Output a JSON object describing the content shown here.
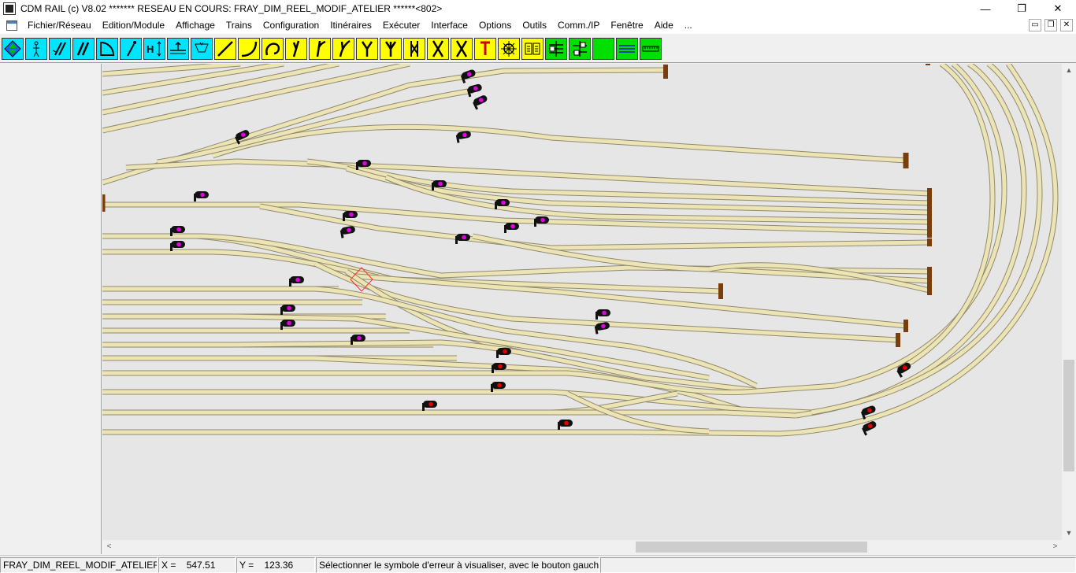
{
  "window": {
    "title": "CDM RAIL (c) V8.02      ******* RESEAU EN COURS: FRAY_DIM_REEL_MODIF_ATELIER ******<802>",
    "minimize": "—",
    "maximize": "❐",
    "close": "✕"
  },
  "menu": {
    "items": [
      "Fichier/Réseau",
      "Edition/Module",
      "Affichage",
      "Trains",
      "Configuration",
      "Itinéraires",
      "Exécuter",
      "Interface",
      "Options",
      "Outils",
      "Comm./IP",
      "Fenêtre",
      "Aide",
      "..."
    ],
    "mdi_min": "▭",
    "mdi_restore": "❐",
    "mdi_close": "✕"
  },
  "toolbar": {
    "colors": {
      "cyan": "#00e5ff",
      "yellow": "#ffff00",
      "green": "#00e000",
      "blue": "#1060ff"
    },
    "buttons": [
      {
        "name": "select-tool",
        "icon": "diamond-arrows-icon",
        "color": "cyan"
      },
      {
        "name": "track-tool",
        "icon": "stickman-icon",
        "color": "cyan"
      },
      {
        "name": "diagonal-tool",
        "icon": "diagonal-lines-icon",
        "color": "cyan"
      },
      {
        "name": "double-track-tool",
        "icon": "double-lines-icon",
        "color": "cyan"
      },
      {
        "name": "curve-tool",
        "icon": "curve-shape-icon",
        "color": "cyan"
      },
      {
        "name": "point-tool",
        "icon": "dot-line-icon",
        "color": "cyan"
      },
      {
        "name": "height-tool",
        "icon": "height-icon",
        "color": "cyan"
      },
      {
        "name": "level-tool",
        "icon": "level-icon",
        "color": "cyan"
      },
      {
        "name": "terrain-tool",
        "icon": "terrain-icon",
        "color": "cyan"
      },
      {
        "name": "straight-rail-tool",
        "icon": "straight-rail-icon",
        "color": "yellow"
      },
      {
        "name": "curved-rail-tool",
        "icon": "curved-rail-icon",
        "color": "yellow"
      },
      {
        "name": "loop-rail-tool",
        "icon": "loop-rail-icon",
        "color": "yellow"
      },
      {
        "name": "left-turnout-tool",
        "icon": "left-turnout-icon",
        "color": "yellow"
      },
      {
        "name": "right-turnout-tool",
        "icon": "right-turnout-icon",
        "color": "yellow"
      },
      {
        "name": "curved-turnout-tool",
        "icon": "curved-turnout-icon",
        "color": "yellow"
      },
      {
        "name": "y-turnout-tool",
        "icon": "y-turnout-icon",
        "color": "yellow"
      },
      {
        "name": "three-way-tool",
        "icon": "three-way-icon",
        "color": "yellow"
      },
      {
        "name": "double-slip-tool",
        "icon": "double-slip-icon",
        "color": "yellow"
      },
      {
        "name": "crossing-tool",
        "icon": "crossing-icon",
        "color": "yellow"
      },
      {
        "name": "diamond-tool",
        "icon": "diamond-crossing-icon",
        "color": "yellow"
      },
      {
        "name": "buffer-tool",
        "icon": "buffer-stop-icon",
        "color": "yellow"
      },
      {
        "name": "turntable-tool",
        "icon": "turntable-icon",
        "color": "yellow"
      },
      {
        "name": "book-tool",
        "icon": "book-icon",
        "color": "yellow"
      },
      {
        "name": "module-tool",
        "icon": "module-icon",
        "color": "green"
      },
      {
        "name": "module-link-tool",
        "icon": "module-link-icon",
        "color": "green"
      },
      {
        "name": "blank-tool",
        "icon": "blank-icon",
        "color": "green"
      },
      {
        "name": "lines-tool",
        "icon": "stripes-icon",
        "color": "green"
      },
      {
        "name": "ruler-tool",
        "icon": "ruler-icon",
        "color": "green"
      }
    ]
  },
  "layout": {
    "track_color": "#ede4b5",
    "track_edge": "#8f8a6f",
    "buffer_color": "#7a3d0c",
    "signal_body": "#111111",
    "signal_lamp_magenta": "#e100e1",
    "signal_lamp_red": "#e00000",
    "error_marker_color": "#ff3030"
  },
  "status": {
    "module": "FRAY_DIM_REEL_MODIF_ATELIER_TOP",
    "x_label": "X =",
    "x_value": "547.51",
    "y_label": "Y =",
    "y_value": "123.36",
    "message": "Sélectionner le symbole d'erreur à visualiser, avec le bouton gauche"
  }
}
